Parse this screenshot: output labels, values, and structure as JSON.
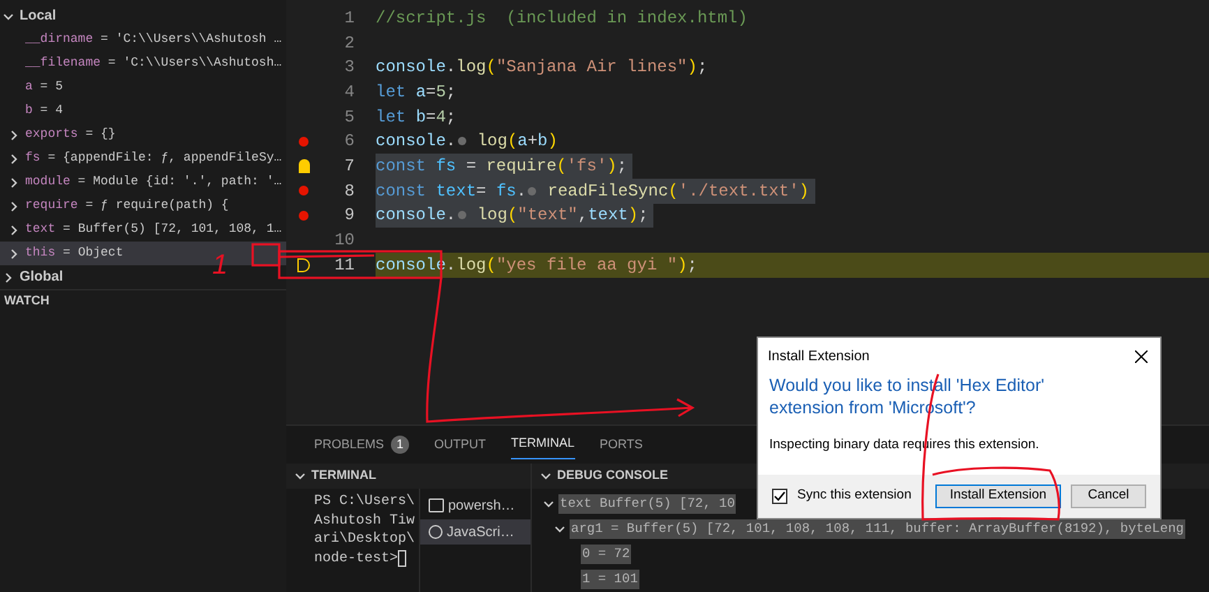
{
  "sidebar": {
    "sections": [
      {
        "label": "Local",
        "expanded": true,
        "variables": [
          {
            "name": "__dirname",
            "separator": "=",
            "value": "'C:\\\\Users\\\\Ashutosh …",
            "kind": "leaf",
            "selected": false
          },
          {
            "name": "__filename",
            "separator": "=",
            "value": "'C:\\\\Users\\\\Ashutosh…",
            "kind": "leaf",
            "selected": false
          },
          {
            "name": "a",
            "separator": "=",
            "value": "5",
            "kind": "leaf",
            "selected": false
          },
          {
            "name": "b",
            "separator": "=",
            "value": "4",
            "kind": "leaf",
            "selected": false
          },
          {
            "name": "exports",
            "separator": "=",
            "value": "{}",
            "kind": "object",
            "selected": false
          },
          {
            "name": "fs",
            "separator": "=",
            "value": "{appendFile: ƒ, appendFileSy…",
            "kind": "object",
            "selected": false
          },
          {
            "name": "module",
            "separator": "=",
            "value": "Module {id: '.', path: '…",
            "kind": "object",
            "selected": false
          },
          {
            "name": "require",
            "separator": "=",
            "value": "ƒ require(path) {",
            "kind": "object",
            "selected": false
          },
          {
            "name": "text",
            "separator": "=",
            "value": "Buffer(5) [72, 101, 108, 1…",
            "kind": "object",
            "selected": false
          },
          {
            "name": "this",
            "separator": "=",
            "value": "Object",
            "kind": "object",
            "selected": true
          }
        ]
      },
      {
        "label": "Global",
        "expanded": false
      }
    ],
    "watch": {
      "label": "WATCH"
    }
  },
  "editor": {
    "lines": [
      {
        "number": "1",
        "breakpoint": false,
        "lightbulb": false,
        "selected": false,
        "paused": false,
        "tokens": [
          {
            "kind": "comment",
            "text": "//script.js  (included in index.html)"
          }
        ]
      },
      {
        "number": "2",
        "breakpoint": false,
        "lightbulb": false,
        "selected": false,
        "paused": false
      },
      {
        "number": "3",
        "breakpoint": false,
        "lightbulb": false,
        "selected": false,
        "paused": false,
        "tokens": [
          {
            "kind": "var",
            "text": "console"
          },
          {
            "kind": "punct",
            "text": "."
          },
          {
            "kind": "fn",
            "text": "log"
          },
          {
            "kind": "bracket",
            "text": "("
          },
          {
            "kind": "string",
            "text": "\"Sanjana Air lines\""
          },
          {
            "kind": "bracket",
            "text": ")"
          },
          {
            "kind": "punct",
            "text": ";"
          }
        ]
      },
      {
        "number": "4",
        "breakpoint": false,
        "lightbulb": false,
        "selected": false,
        "paused": false,
        "tokens": [
          {
            "kind": "keyword",
            "text": "let "
          },
          {
            "kind": "var",
            "text": "a"
          },
          {
            "kind": "punct",
            "text": "="
          },
          {
            "kind": "number",
            "text": "5"
          },
          {
            "kind": "punct",
            "text": ";"
          }
        ]
      },
      {
        "number": "5",
        "breakpoint": false,
        "lightbulb": false,
        "selected": false,
        "paused": false,
        "tokens": [
          {
            "kind": "keyword",
            "text": "let "
          },
          {
            "kind": "var",
            "text": "b"
          },
          {
            "kind": "punct",
            "text": "="
          },
          {
            "kind": "number",
            "text": "4"
          },
          {
            "kind": "punct",
            "text": ";"
          }
        ]
      },
      {
        "number": "6",
        "breakpoint": true,
        "lightbulb": false,
        "selected": false,
        "paused": false,
        "tokens": [
          {
            "kind": "var",
            "text": "console"
          },
          {
            "kind": "punct",
            "text": "."
          },
          {
            "kind": "dot"
          },
          {
            "kind": "fn",
            "text": " log"
          },
          {
            "kind": "bracket",
            "text": "("
          },
          {
            "kind": "var",
            "text": "a"
          },
          {
            "kind": "punct",
            "text": "+"
          },
          {
            "kind": "var",
            "text": "b"
          },
          {
            "kind": "bracket",
            "text": ")"
          }
        ]
      },
      {
        "number": "7",
        "breakpoint": false,
        "lightbulb": true,
        "selected": true,
        "paused": false,
        "tokens": [
          {
            "kind": "keyword",
            "text": "const "
          },
          {
            "kind": "const",
            "text": "fs"
          },
          {
            "kind": "punct",
            "text": " = "
          },
          {
            "kind": "fn",
            "text": "require"
          },
          {
            "kind": "bracket",
            "text": "("
          },
          {
            "kind": "string",
            "text": "'fs'"
          },
          {
            "kind": "bracket",
            "text": ")"
          },
          {
            "kind": "punct",
            "text": ";"
          }
        ]
      },
      {
        "number": "8",
        "breakpoint": true,
        "lightbulb": false,
        "selected": true,
        "paused": false,
        "tokens": [
          {
            "kind": "keyword",
            "text": "const "
          },
          {
            "kind": "const",
            "text": "text"
          },
          {
            "kind": "punct",
            "text": "= "
          },
          {
            "kind": "const",
            "text": "fs"
          },
          {
            "kind": "punct",
            "text": "."
          },
          {
            "kind": "dot"
          },
          {
            "kind": "fn",
            "text": " readFileSync"
          },
          {
            "kind": "bracket",
            "text": "("
          },
          {
            "kind": "string",
            "text": "'./text.txt'"
          },
          {
            "kind": "bracket",
            "text": ")"
          }
        ]
      },
      {
        "number": "9",
        "breakpoint": true,
        "lightbulb": false,
        "selected": true,
        "paused": false,
        "tokens": [
          {
            "kind": "var",
            "text": "console"
          },
          {
            "kind": "punct",
            "text": "."
          },
          {
            "kind": "dot"
          },
          {
            "kind": "fn",
            "text": " log"
          },
          {
            "kind": "bracket",
            "text": "("
          },
          {
            "kind": "string",
            "text": "\"text\""
          },
          {
            "kind": "punct",
            "text": ","
          },
          {
            "kind": "var",
            "text": "text"
          },
          {
            "kind": "bracket",
            "text": ")"
          },
          {
            "kind": "punct",
            "text": ";"
          }
        ]
      },
      {
        "number": "10",
        "breakpoint": false,
        "lightbulb": false,
        "selected": false,
        "paused": false
      },
      {
        "number": "11",
        "breakpoint": false,
        "lightbulb": false,
        "selected": false,
        "paused": true,
        "tokens": [
          {
            "kind": "var",
            "text": "console"
          },
          {
            "kind": "punct",
            "text": "."
          },
          {
            "kind": "fn",
            "text": "log"
          },
          {
            "kind": "bracket",
            "text": "("
          },
          {
            "kind": "string",
            "text": "\"yes file aa gyi \""
          },
          {
            "kind": "bracket",
            "text": ")"
          },
          {
            "kind": "punct",
            "text": ";"
          }
        ]
      }
    ]
  },
  "panel": {
    "tabs": [
      {
        "label": "PROBLEMS",
        "badge": "1",
        "selected": false
      },
      {
        "label": "OUTPUT",
        "selected": false
      },
      {
        "label": "TERMINAL",
        "selected": true
      },
      {
        "label": "PORTS",
        "selected": false
      }
    ],
    "terminal": {
      "header": "TERMINAL",
      "expanded": true,
      "lines": [
        "PS C:\\Users\\",
        "Ashutosh Tiw",
        "ari\\Desktop\\",
        "node-test>"
      ],
      "sessions": [
        {
          "label": "powersh…",
          "kind": "shell",
          "selected": false
        },
        {
          "label": "JavaScri…",
          "kind": "debug",
          "selected": true
        }
      ]
    },
    "debug_console": {
      "header": "DEBUG CONSOLE",
      "expanded": true,
      "rows": [
        {
          "text": "text Buffer(5) [72, 10",
          "expanded": true,
          "children": [
            {
              "text": "arg1 = Buffer(5) [72, 101, 108, 108, 111, buffer: ArrayBuffer(8192), byteLeng",
              "expanded": true,
              "children": [
                {
                  "text": "0 = 72"
                },
                {
                  "text": "1 = 101"
                }
              ]
            }
          ]
        }
      ]
    }
  },
  "dialog": {
    "title": "Install Extension",
    "heading": "Would you like to install 'Hex Editor' extension from 'Microsoft'?",
    "message": "Inspecting binary data requires this extension.",
    "checkbox": {
      "label": "Sync this extension",
      "checked": true
    },
    "buttons": [
      {
        "label": "Install Extension",
        "primary": true
      },
      {
        "label": "Cancel",
        "primary": false
      }
    ]
  },
  "annotation": {
    "label": "1"
  }
}
